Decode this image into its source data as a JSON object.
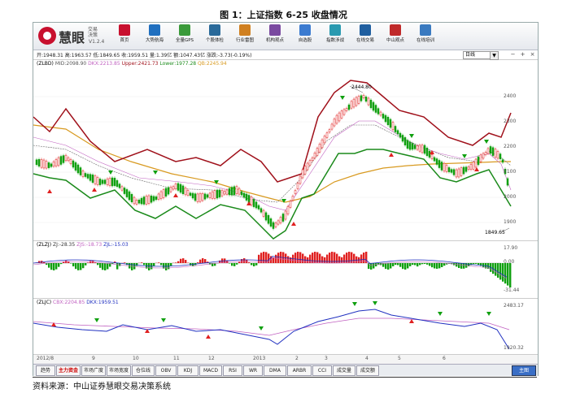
{
  "figure_title": "图 1：上证指数 6-25 收盘情况",
  "source_note": "资料来源：中山证券慧眼交易决策系统",
  "app": {
    "logo_name": "慧眼",
    "logo_sub": "交易决策",
    "version": "V1.2.4",
    "toolbar": [
      {
        "label": "首页",
        "color": "#c8102e"
      },
      {
        "label": "大势航海",
        "color": "#1f6fbf"
      },
      {
        "label": "全量GPS",
        "color": "#3a9a3a"
      },
      {
        "label": "个股体检",
        "color": "#2a6a9a"
      },
      {
        "label": "行业雷图",
        "color": "#d08020"
      },
      {
        "label": "机构观点",
        "color": "#7a4aa0"
      },
      {
        "label": "自选股",
        "color": "#3b7bd0"
      },
      {
        "label": "指数涉战",
        "color": "#2a9ab0"
      },
      {
        "label": "在线交易",
        "color": "#1f5fa0"
      },
      {
        "label": "中山观点",
        "color": "#c02a2a"
      },
      {
        "label": "在线培训",
        "color": "#3a7ac0"
      }
    ]
  },
  "infobar": {
    "quote": "开:1948.31  高:1963.57  低:1849.65  收:1959.51  量:1.39亿  额:1047.43亿  涨跌:-3.73(-0.19%)",
    "period": "日线"
  },
  "panels": {
    "main": {
      "indicator": "ZLBD",
      "mid": "MID:2098.90",
      "dkx": "DKX:2213.85",
      "upper": "Upper:2421.73",
      "lower": "Lower:1977.28",
      "qb": "QB:2245.94",
      "peak_label": "2444.80",
      "trough_label": "1849.65",
      "y_ticks": [
        "2400",
        "2300",
        "2200",
        "2100",
        "2000",
        "1900"
      ]
    },
    "zlzj": {
      "indicator": "ZLZJ",
      "zj": "ZJ:-28.35",
      "zjs": "ZJS:-18.73",
      "zjl": "ZJL:-15.03",
      "y_ticks": [
        "17.90",
        "0.00",
        "-31.44"
      ]
    },
    "zljc": {
      "indicator": "ZLJC",
      "cbx": "CBX:2204.85",
      "dkx": "DKX:1959.51",
      "y_ticks": [
        "2483.17",
        "1920.32"
      ]
    }
  },
  "date_axis": [
    "2012/8",
    "9",
    "10",
    "11",
    "12",
    "2013",
    "2",
    "3",
    "4",
    "5",
    "6"
  ],
  "bottom_tabs": [
    "趋势",
    "主力资金",
    "市场广度",
    "市场宽度",
    "仓位线",
    "OBV",
    "KDJ",
    "MACD",
    "RSI",
    "WR",
    "DMA",
    "ARBR",
    "CCI",
    "成交量",
    "成交额"
  ],
  "main_button": "主图",
  "colors": {
    "upper_band": "#a0111b",
    "lower_band": "#1a8a1a",
    "mid_line": "#666666",
    "qb_line": "#d89a20",
    "dkx_line": "#c060c0",
    "up_candle": "#e02020",
    "down_candle": "#10a010",
    "blue_line": "#2030c0"
  }
}
